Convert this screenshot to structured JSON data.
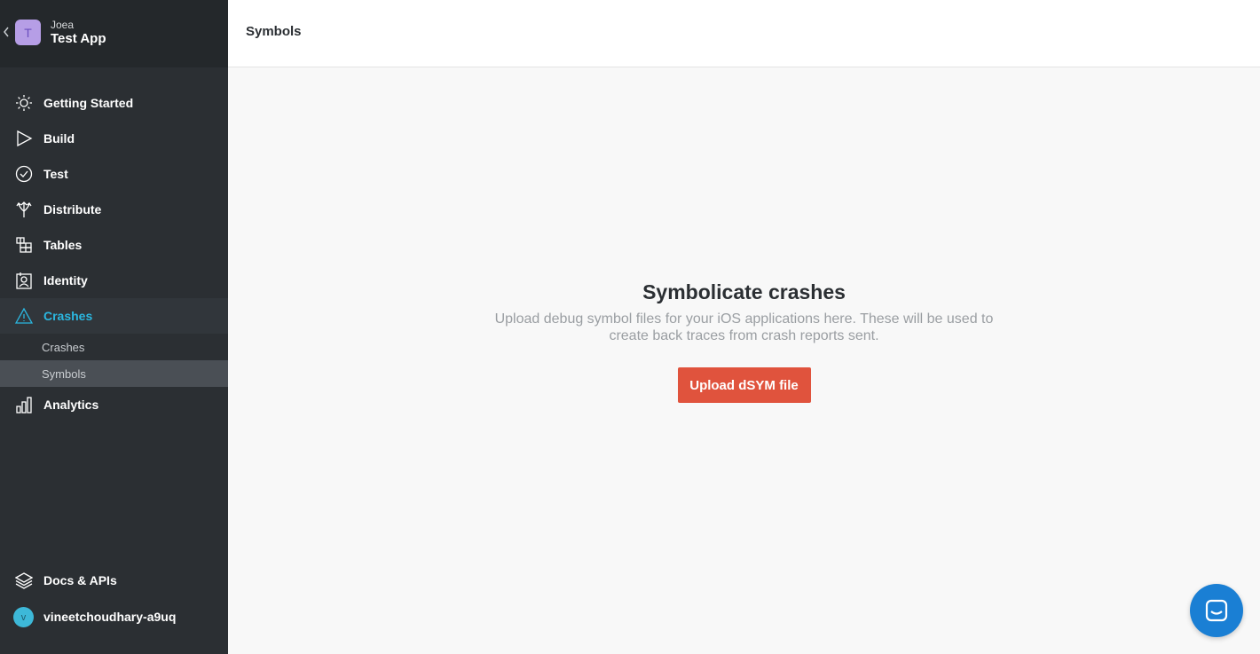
{
  "app": {
    "org_name": "Joea",
    "app_name": "Test App",
    "avatar_letter": "T",
    "avatar_color": "#b69ee6"
  },
  "sidebar": {
    "items": [
      {
        "label": "Getting Started",
        "icon": "sun-icon"
      },
      {
        "label": "Build",
        "icon": "play-icon"
      },
      {
        "label": "Test",
        "icon": "check-circle-icon"
      },
      {
        "label": "Distribute",
        "icon": "distribute-arrows-icon"
      },
      {
        "label": "Tables",
        "icon": "tables-icon"
      },
      {
        "label": "Identity",
        "icon": "identity-icon"
      },
      {
        "label": "Crashes",
        "icon": "warning-triangle-icon",
        "active": true
      },
      {
        "label": "Analytics",
        "icon": "bar-chart-icon"
      }
    ],
    "crashes_sub": [
      {
        "label": "Crashes"
      },
      {
        "label": "Symbols",
        "selected": true
      }
    ],
    "bottom": {
      "docs_label": "Docs & APIs",
      "user_name": "vineetchoudhary-a9uq",
      "user_avatar_letter": "v"
    }
  },
  "header": {
    "title": "Symbols"
  },
  "main": {
    "empty_title": "Symbolicate crashes",
    "empty_description": "Upload debug symbol files for your iOS applications here. These will be used to create back traces from crash reports sent.",
    "upload_button": "Upload dSYM file"
  },
  "colors": {
    "sidebar_bg": "#2b2f33",
    "accent": "#2bb7e0",
    "primary_button": "#e0533d",
    "chat_launcher": "#1a7fd4"
  }
}
